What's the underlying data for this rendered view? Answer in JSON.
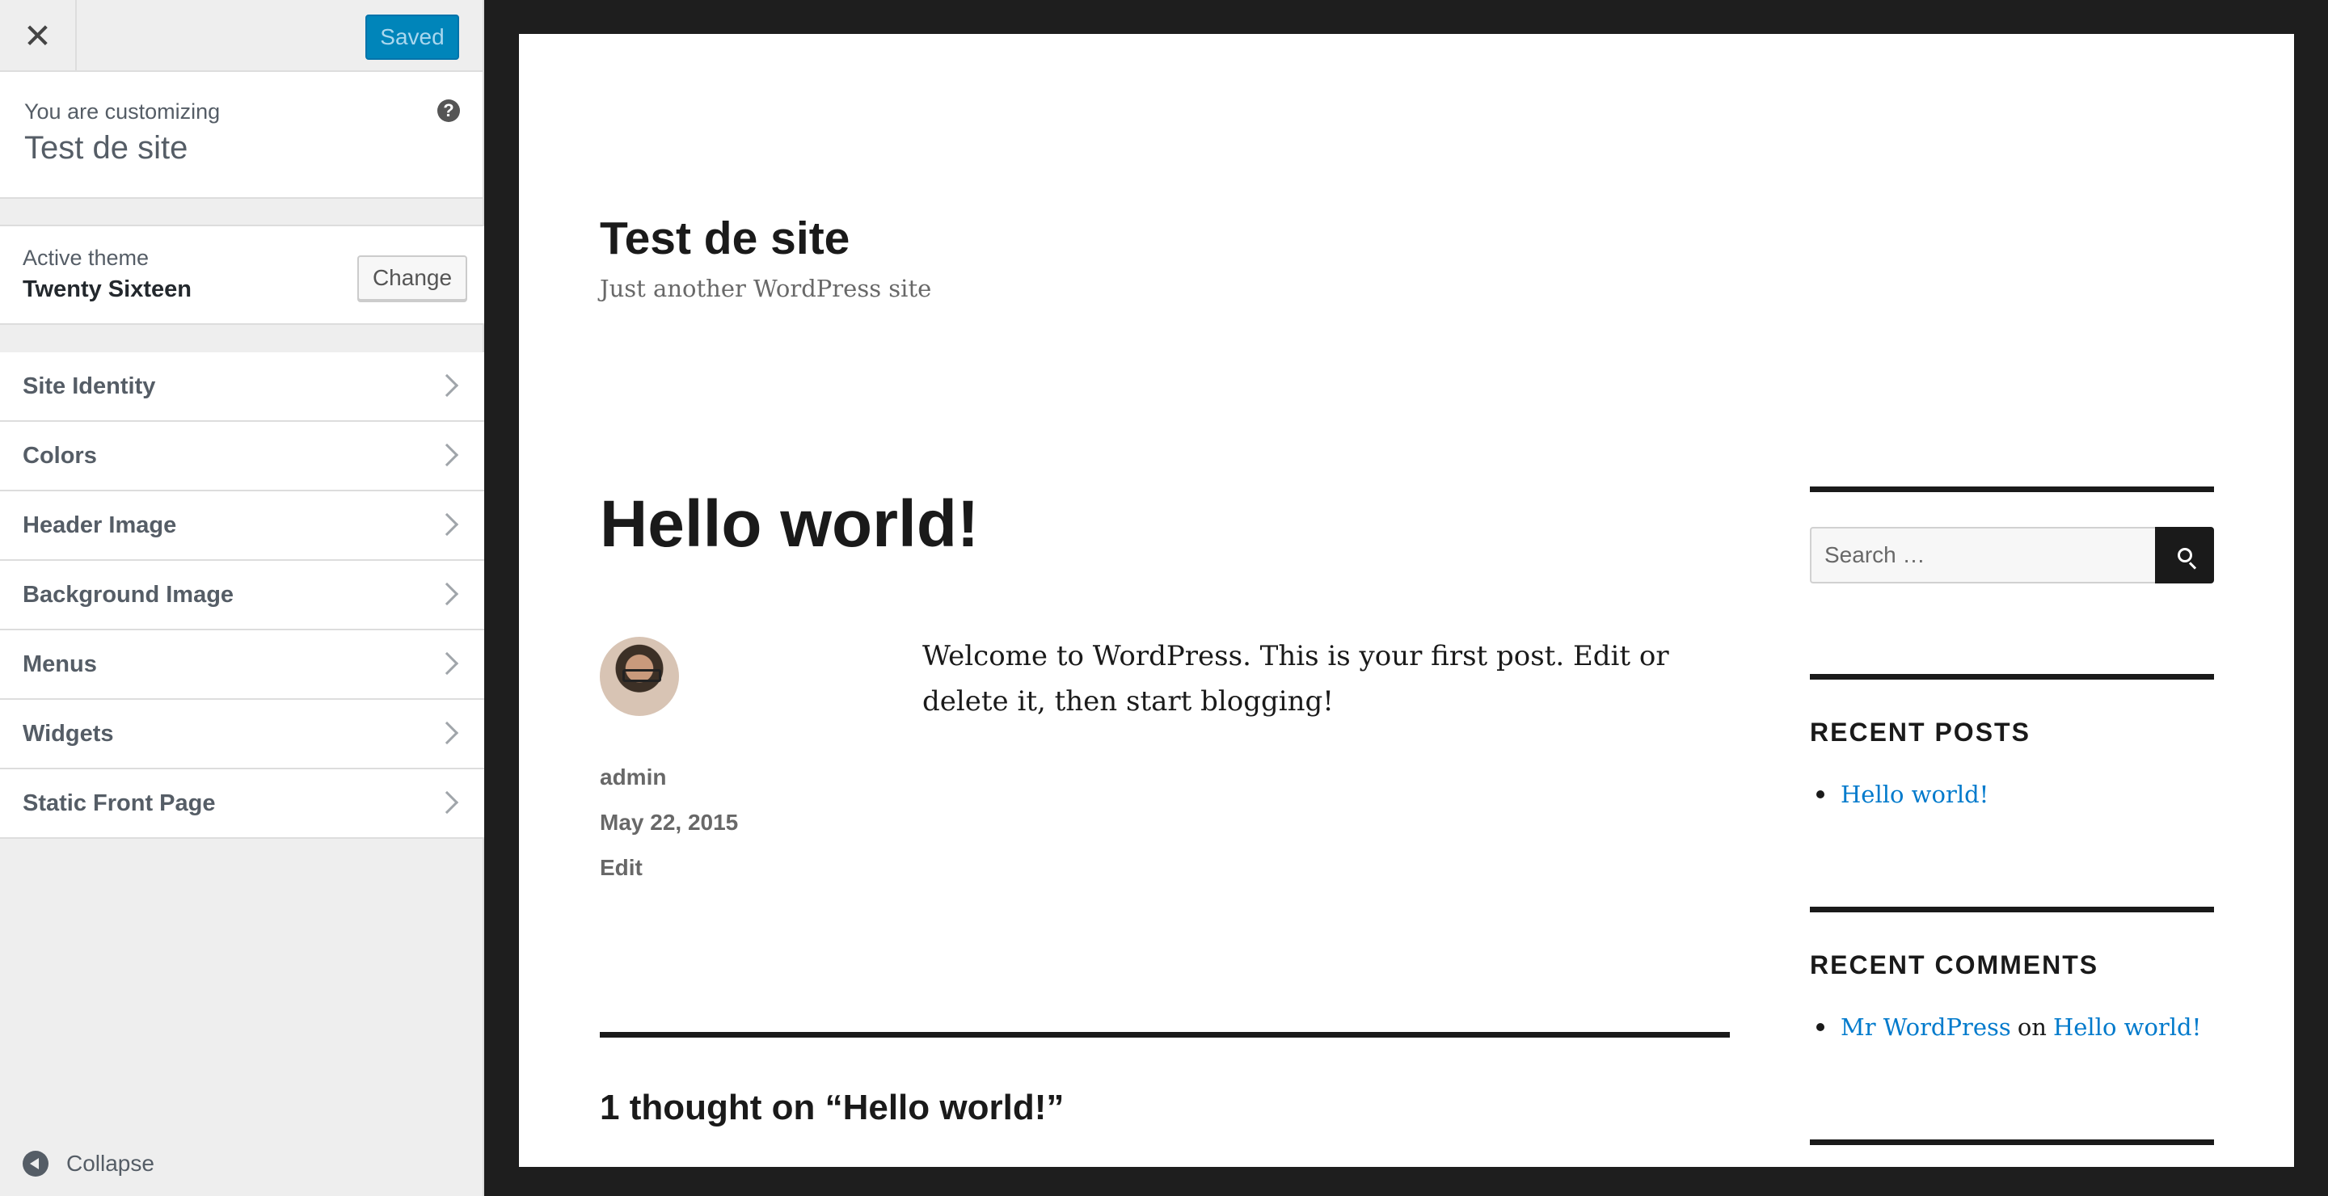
{
  "customizer": {
    "close_icon": "close-icon",
    "saved_label": "Saved",
    "customizing_label": "You are customizing",
    "site_name": "Test de site",
    "help_icon": "help-icon",
    "active_theme_label": "Active theme",
    "theme_name": "Twenty Sixteen",
    "change_label": "Change",
    "panels": [
      {
        "label": "Site Identity"
      },
      {
        "label": "Colors"
      },
      {
        "label": "Header Image"
      },
      {
        "label": "Background Image"
      },
      {
        "label": "Menus"
      },
      {
        "label": "Widgets"
      },
      {
        "label": "Static Front Page"
      }
    ],
    "collapse_label": "Collapse"
  },
  "preview": {
    "site_title": "Test de site",
    "site_description": "Just another WordPress site",
    "post": {
      "title": "Hello world!",
      "author": "admin",
      "date": "May 22, 2015",
      "edit_label": "Edit",
      "body": "Welcome to WordPress. This is your first post. Edit or delete it, then start blogging!"
    },
    "comments_title": "1 thought on “Hello world!”",
    "sidebar": {
      "search_placeholder": "Search …",
      "recent_posts_title": "RECENT POSTS",
      "recent_posts": [
        "Hello world!"
      ],
      "recent_comments_title": "RECENT COMMENTS",
      "recent_comment": {
        "author": "Mr WordPress",
        "on": "on",
        "post": "Hello world!"
      }
    }
  },
  "colors": {
    "accent": "#0085ba",
    "link": "#007acc"
  }
}
